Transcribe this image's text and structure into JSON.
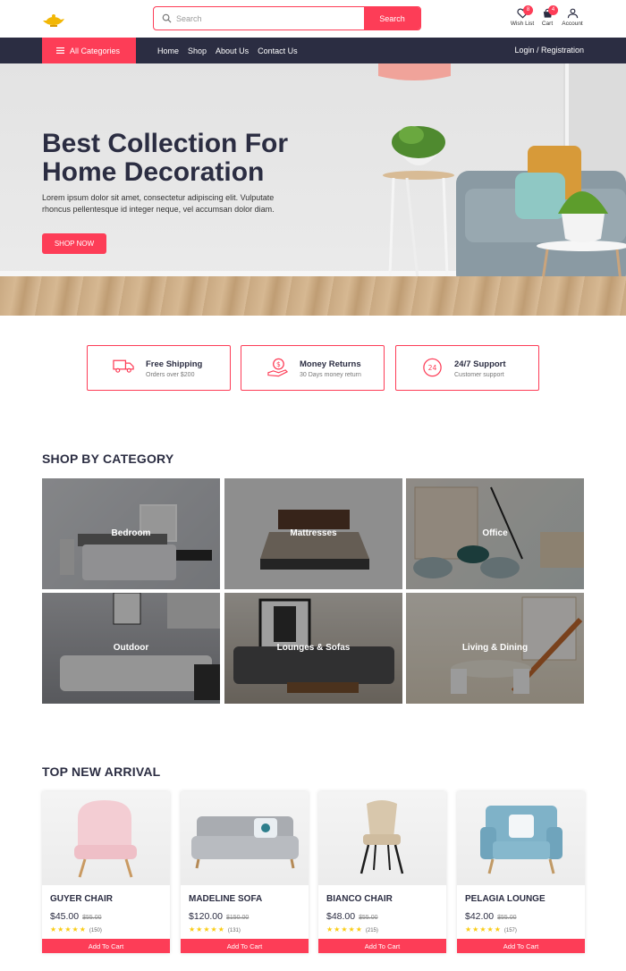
{
  "header": {
    "search_placeholder": "Search",
    "search_button": "Search",
    "wishlist_label": "Wish List",
    "wishlist_count": "8",
    "cart_label": "Cart",
    "cart_count": "4",
    "account_label": "Account"
  },
  "nav": {
    "all_categories": "All Categories",
    "links": [
      "Home",
      "Shop",
      "About Us",
      "Contact Us"
    ],
    "login": "Login / Registration"
  },
  "hero": {
    "title": "Best Collection For Home Decoration",
    "text": "Lorem ipsum dolor sit amet, consectetur adipiscing elit. Vulputate rhoncus pellentesque id integer neque, vel accumsan dolor diam.",
    "button": "SHOP NOW"
  },
  "features": [
    {
      "title": "Free Shipping",
      "subtitle": "Orders over $200",
      "icon": "truck-icon"
    },
    {
      "title": "Money Returns",
      "subtitle": "30 Days money return",
      "icon": "money-hand-icon"
    },
    {
      "title": "24/7 Support",
      "subtitle": "Customer support",
      "icon": "support-24-icon"
    }
  ],
  "categories_title": "SHOP BY CATEGORY",
  "categories": [
    "Bedroom",
    "Mattresses",
    "Office",
    "Outdoor",
    "Lounges & Sofas",
    "Living & Dining"
  ],
  "arrivals_title": "TOP NEW ARRIVAL",
  "products": [
    {
      "name": "GUYER CHAIR",
      "price": "$45.00",
      "old_price": "$55.00",
      "stars": "★★★★★",
      "reviews": "(150)",
      "button": "Add To Cart"
    },
    {
      "name": "MADELINE SOFA",
      "price": "$120.00",
      "old_price": "$150.00",
      "stars": "★★★★★",
      "reviews": "(131)",
      "button": "Add To Cart"
    },
    {
      "name": "BIANCO CHAIR",
      "price": "$48.00",
      "old_price": "$55.00",
      "stars": "★★★★★",
      "reviews": "(215)",
      "button": "Add To Cart"
    },
    {
      "name": "PELAGIA LOUNGE",
      "price": "$42.00",
      "old_price": "$55.00",
      "stars": "★★★★★",
      "reviews": "(157)",
      "button": "Add To Cart"
    }
  ],
  "colors": {
    "accent": "#fd3d57",
    "dark": "#2b2d42",
    "star": "#facc15"
  }
}
